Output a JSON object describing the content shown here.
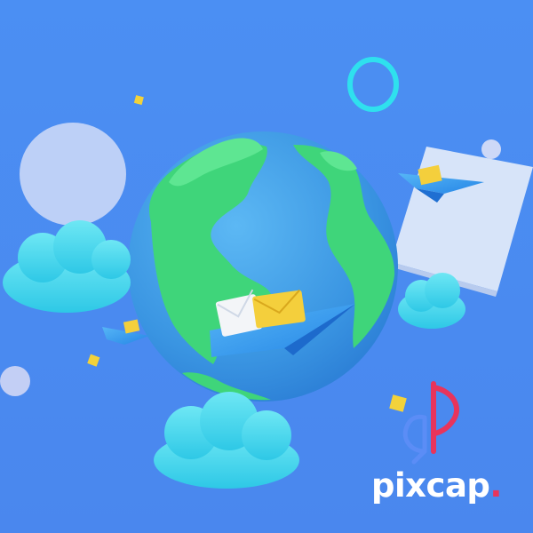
{
  "brand": {
    "name": "pixcap",
    "name_dot": "."
  },
  "colors": {
    "background": "#4a8cf2",
    "globe_ocean": "#3f9ce6",
    "globe_land": "#3fd57a",
    "cloud": "#45d9ee",
    "ring": "#2ee0ee",
    "envelope_yellow": "#f4cf3c",
    "envelope_white": "#f3f5f8",
    "plane_blue": "#2f9af0",
    "panel": "#d6e4f8",
    "logo_red": "#e8345b",
    "logo_blue": "#5b8df6"
  },
  "icons": [
    "globe",
    "cloud",
    "paper-plane",
    "envelope",
    "ring",
    "cube",
    "sphere",
    "logo-mark"
  ]
}
